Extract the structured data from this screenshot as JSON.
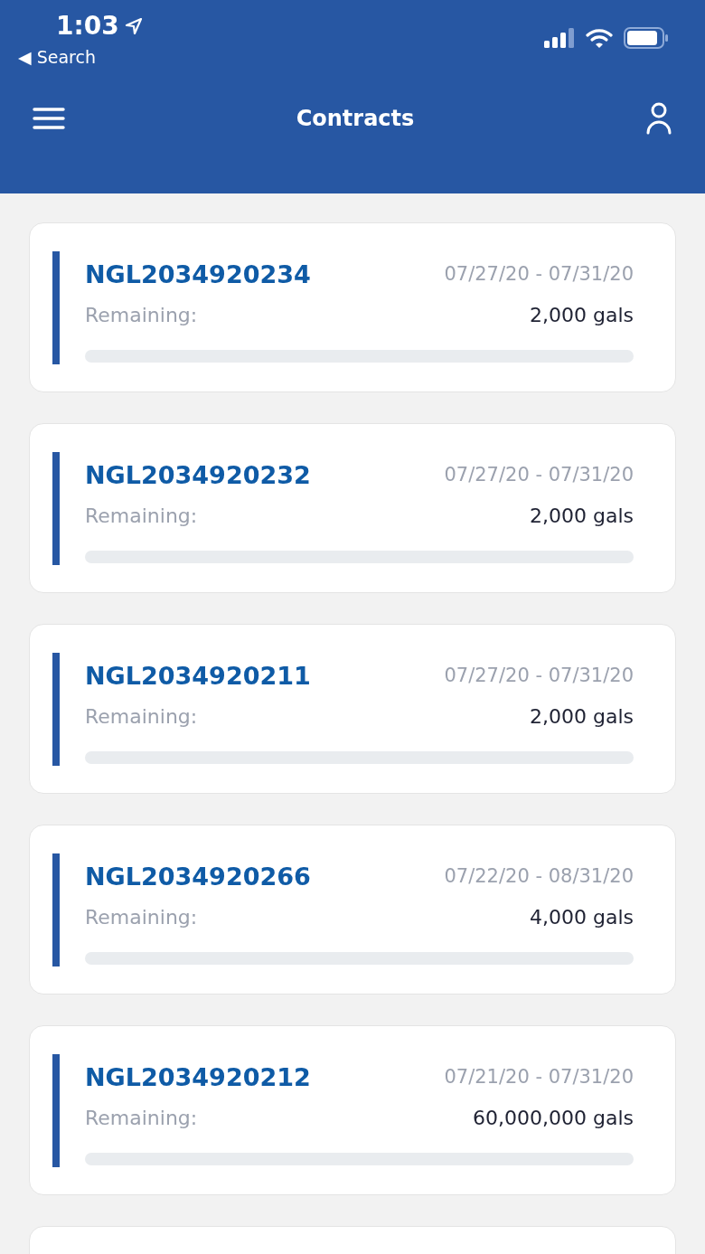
{
  "status_bar": {
    "time": "1:03",
    "back_label": "◀ Search"
  },
  "header": {
    "title": "Contracts"
  },
  "contracts": [
    {
      "number": "NGL2034920234",
      "dates": "07/27/20 - 07/31/20",
      "remaining_label": "Remaining:",
      "remaining": "2,000 gals",
      "level": 0
    },
    {
      "number": "NGL2034920232",
      "dates": "07/27/20 - 07/31/20",
      "remaining_label": "Remaining:",
      "remaining": "2,000 gals",
      "level": 0
    },
    {
      "number": "NGL2034920211",
      "dates": "07/27/20 - 07/31/20",
      "remaining_label": "Remaining:",
      "remaining": "2,000 gals",
      "level": 0
    },
    {
      "number": "NGL2034920266",
      "dates": "07/22/20 - 08/31/20",
      "remaining_label": "Remaining:",
      "remaining": "4,000 gals",
      "level": 0
    },
    {
      "number": "NGL2034920212",
      "dates": "07/21/20 - 07/31/20",
      "remaining_label": "Remaining:",
      "remaining": "60,000,000 gals",
      "level": 0
    }
  ]
}
